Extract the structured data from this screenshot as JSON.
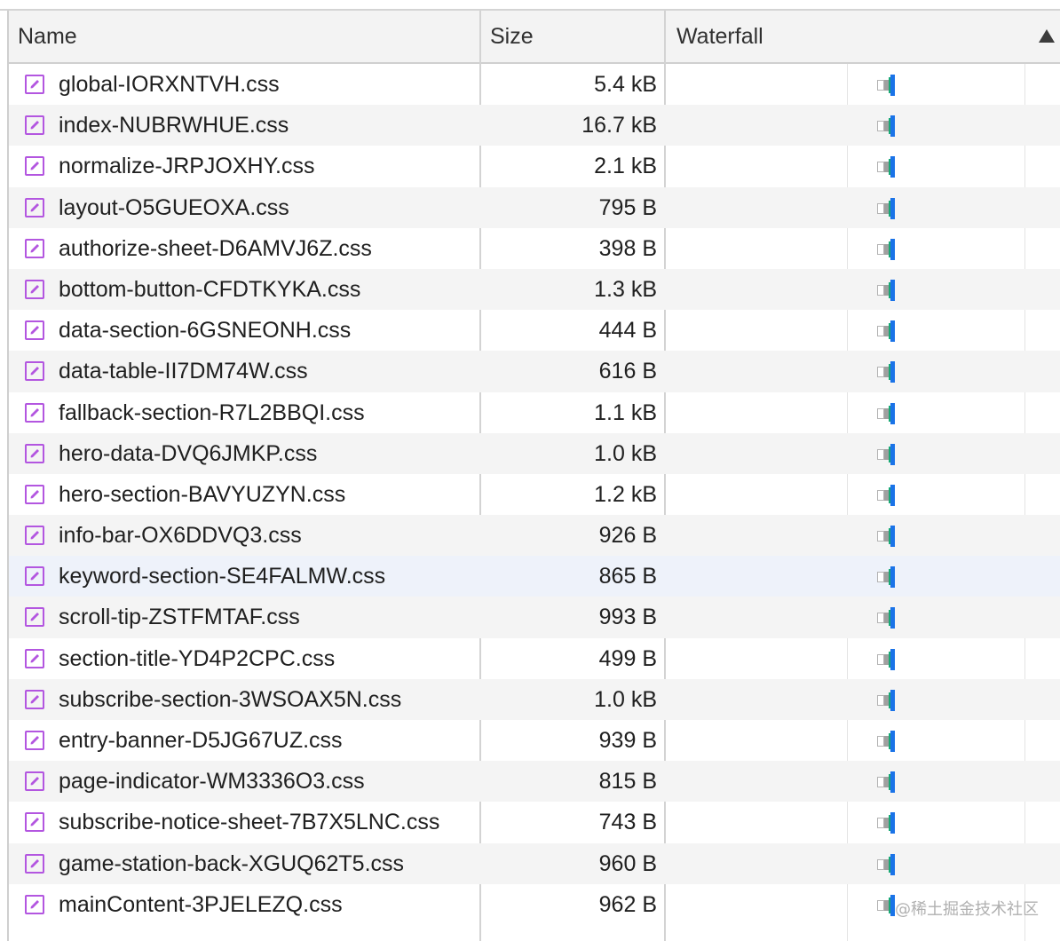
{
  "columns": {
    "name": "Name",
    "size": "Size",
    "waterfall": "Waterfall"
  },
  "rows": [
    {
      "name": "global-IORXNTVH.css",
      "size": "5.4 kB"
    },
    {
      "name": "index-NUBRWHUE.css",
      "size": "16.7 kB"
    },
    {
      "name": "normalize-JRPJOXHY.css",
      "size": "2.1 kB"
    },
    {
      "name": "layout-O5GUEOXA.css",
      "size": "795 B"
    },
    {
      "name": "authorize-sheet-D6AMVJ6Z.css",
      "size": "398 B"
    },
    {
      "name": "bottom-button-CFDTKYKA.css",
      "size": "1.3 kB"
    },
    {
      "name": "data-section-6GSNEONH.css",
      "size": "444 B"
    },
    {
      "name": "data-table-II7DM74W.css",
      "size": "616 B"
    },
    {
      "name": "fallback-section-R7L2BBQI.css",
      "size": "1.1 kB"
    },
    {
      "name": "hero-data-DVQ6JMKP.css",
      "size": "1.0 kB"
    },
    {
      "name": "hero-section-BAVYUZYN.css",
      "size": "1.2 kB"
    },
    {
      "name": "info-bar-OX6DDVQ3.css",
      "size": "926 B"
    },
    {
      "name": "keyword-section-SE4FALMW.css",
      "size": "865 B"
    },
    {
      "name": "scroll-tip-ZSTFMTAF.css",
      "size": "993 B"
    },
    {
      "name": "section-title-YD4P2CPC.css",
      "size": "499 B"
    },
    {
      "name": "subscribe-section-3WSOAX5N.css",
      "size": "1.0 kB"
    },
    {
      "name": "entry-banner-D5JG67UZ.css",
      "size": "939 B"
    },
    {
      "name": "page-indicator-WM3336O3.css",
      "size": "815 B"
    },
    {
      "name": "subscribe-notice-sheet-7B7X5LNC.css",
      "size": "743 B"
    },
    {
      "name": "game-station-back-XGUQ62T5.css",
      "size": "960 B"
    },
    {
      "name": "mainContent-3PJELEZQ.css",
      "size": "962 B"
    }
  ],
  "watermark": "@稀土掘金技术社区",
  "colors": {
    "file_icon": "#b356e0",
    "wf_blue": "#1a73e8",
    "wf_green": "#19a974",
    "header_bg": "#f3f3f3",
    "row_alt": "#f4f4f4",
    "row_highlight": "#eef2fa"
  },
  "icons": {
    "file": "stylesheet-file-icon",
    "sort": "sort-ascending-icon"
  },
  "highlighted_row": 12
}
